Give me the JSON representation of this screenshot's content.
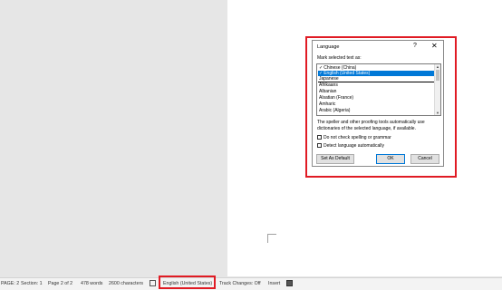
{
  "dialog": {
    "title": "Language",
    "help_glyph": "?",
    "close_glyph": "✕",
    "mark_label": "Mark selected text as:",
    "languages": [
      {
        "label": "Chinese (China)",
        "checked": true,
        "selected": false
      },
      {
        "label": "English (United States)",
        "checked": true,
        "selected": true
      },
      {
        "label": "Japanese",
        "checked": false,
        "selected": false
      },
      {
        "label": "Afrikaans",
        "checked": false,
        "selected": false
      },
      {
        "label": "Albanian",
        "checked": false,
        "selected": false
      },
      {
        "label": "Alsatian (France)",
        "checked": false,
        "selected": false
      },
      {
        "label": "Amharic",
        "checked": false,
        "selected": false
      },
      {
        "label": "Arabic (Algeria)",
        "checked": false,
        "selected": false
      }
    ],
    "check_glyph": "✓",
    "info_text": "The speller and other proofing tools automatically use dictionaries of the selected language, if available.",
    "checkbox_no_check": "Do not check spelling or grammar",
    "checkbox_detect": "Detect language automatically",
    "btn_default": "Set As Default",
    "btn_ok": "OK",
    "btn_cancel": "Cancel"
  },
  "status_bar": {
    "page": "PAGE: 2",
    "section": "Section: 1",
    "page_of": "Page 2 of 2",
    "words": "478 words",
    "characters": "2600 characters",
    "language": "English (United States)",
    "track_changes": "Track Changes: Off",
    "insert": "Insert"
  },
  "colors": {
    "selection": "#0078d7",
    "highlight": "#e01b24"
  }
}
